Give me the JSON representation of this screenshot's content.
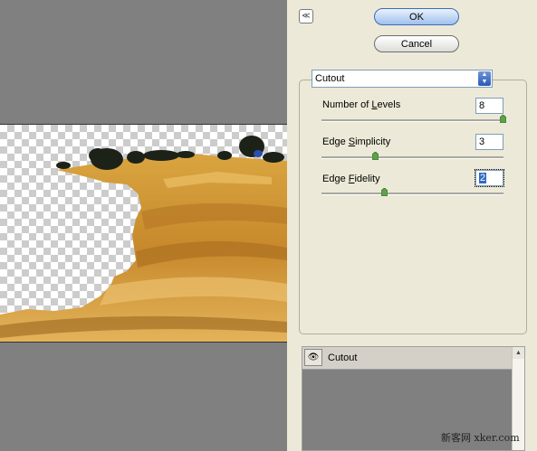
{
  "dialog": {
    "ok_label": "OK",
    "cancel_label": "Cancel",
    "collapse_glyph": "≪",
    "filter_select": "Cutout",
    "params": [
      {
        "label_pre": "Number of ",
        "key": "L",
        "label_post": "evels",
        "value": "8",
        "level": 1.0
      },
      {
        "label_pre": "Edge ",
        "key": "S",
        "label_post": "implicity",
        "value": "3",
        "level": 0.3
      },
      {
        "label_pre": "Edge ",
        "key": "F",
        "label_post": "idelity",
        "value": "2",
        "level": 0.35
      }
    ],
    "layers": [
      {
        "name": "Cutout",
        "eye": "visible"
      }
    ]
  },
  "watermark": "新客网 xker.com",
  "colors": {
    "preview_bg": "#808080",
    "panel_bg": "#ece9d8",
    "ok_blue": "#9fc0ee"
  }
}
